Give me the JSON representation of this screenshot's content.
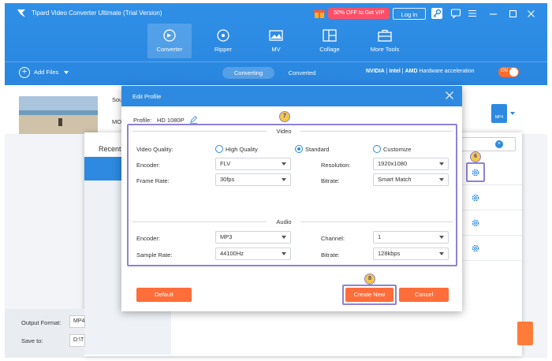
{
  "app": {
    "title": "Tipard Video Converter Ultimate (Trial Version)",
    "promo": "50% OFF to Get VIP",
    "login_label": "Log in",
    "icons": [
      "gift-icon",
      "key-icon",
      "chat-icon",
      "menu-icon",
      "minimize-icon",
      "maximize-icon",
      "close-icon"
    ]
  },
  "nav": {
    "items": [
      {
        "label": "Converter",
        "icon": "converter-icon"
      },
      {
        "label": "Ripper",
        "icon": "ripper-icon"
      },
      {
        "label": "MV",
        "icon": "mv-icon"
      },
      {
        "label": "Collage",
        "icon": "collage-icon"
      },
      {
        "label": "More Tools",
        "icon": "toolbox-icon"
      }
    ],
    "active": "Converter"
  },
  "subbar": {
    "add_files": "Add Files",
    "tab_converting": "Converting",
    "tab_converted": "Converted",
    "hw_nvidia": "NVIDIA",
    "hw_intel": "Intel",
    "hw_amd": "AMD",
    "hw_label": "Hardware acceleration",
    "toggle_label": "ON"
  },
  "background": {
    "source_label": "Sou",
    "mo_label": "MO",
    "format_badge": "MP4",
    "recent_label": "Recent",
    "output_format_label": "Output Format:",
    "output_format_value": "MP4",
    "save_to_label": "Save to:",
    "save_to_value": "D:\\T"
  },
  "dialog": {
    "title": "Edit Profile",
    "profile_label": "Profile:",
    "profile_value": "HD 1080P",
    "video_section": "Video",
    "audio_section": "Audio",
    "video_quality_label": "Video Quality:",
    "quality_options": [
      "High Quality",
      "Standard",
      "Customize"
    ],
    "quality_selected": "Standard",
    "encoder_label": "Encoder:",
    "encoder_value": "FLV",
    "resolution_label": "Resolution:",
    "resolution_value": "1920x1080",
    "frame_rate_label": "Frame Rate:",
    "frame_rate_value": "30fps",
    "bitrate_label": "Bitrate:",
    "bitrate_value": "Smart Match",
    "audio_encoder_label": "Encoder:",
    "audio_encoder_value": "MP3",
    "channel_label": "Channel:",
    "channel_value": "1",
    "sample_rate_label": "Sample Rate:",
    "sample_rate_value": "44100Hz",
    "audio_bitrate_label": "Bitrate:",
    "audio_bitrate_value": "128kbps",
    "default_button": "Default",
    "create_new_button": "Create New",
    "cancel_button": "Cancel"
  },
  "callouts": {
    "step_6": "6",
    "step_7": "7",
    "step_8": "8"
  },
  "colors": {
    "brand_blue": "#2d8ae0",
    "accent_orange": "#ff6d3a",
    "callout_purple": "#8f82d4",
    "callout_yellow": "#f3c74a"
  }
}
